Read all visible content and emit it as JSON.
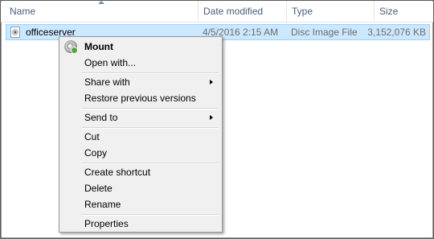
{
  "columns": {
    "name": "Name",
    "date_modified": "Date modified",
    "type": "Type",
    "size": "Size"
  },
  "file": {
    "name": "officeserver",
    "date_modified": "4/5/2016 2:15 AM",
    "type": "Disc Image File",
    "size": "3,152,076 KB",
    "icon": "disc-image-file-icon"
  },
  "context_menu": {
    "mount": "Mount",
    "open_with": "Open with...",
    "share_with": "Share with",
    "restore_previous_versions": "Restore previous versions",
    "send_to": "Send to",
    "cut": "Cut",
    "copy": "Copy",
    "create_shortcut": "Create shortcut",
    "delete": "Delete",
    "rename": "Rename",
    "properties": "Properties"
  },
  "colors": {
    "selection_fill": "#cce8ff",
    "selection_border": "#99d1ff",
    "header_text": "#4c607a",
    "menu_background": "#f0f0f0"
  }
}
